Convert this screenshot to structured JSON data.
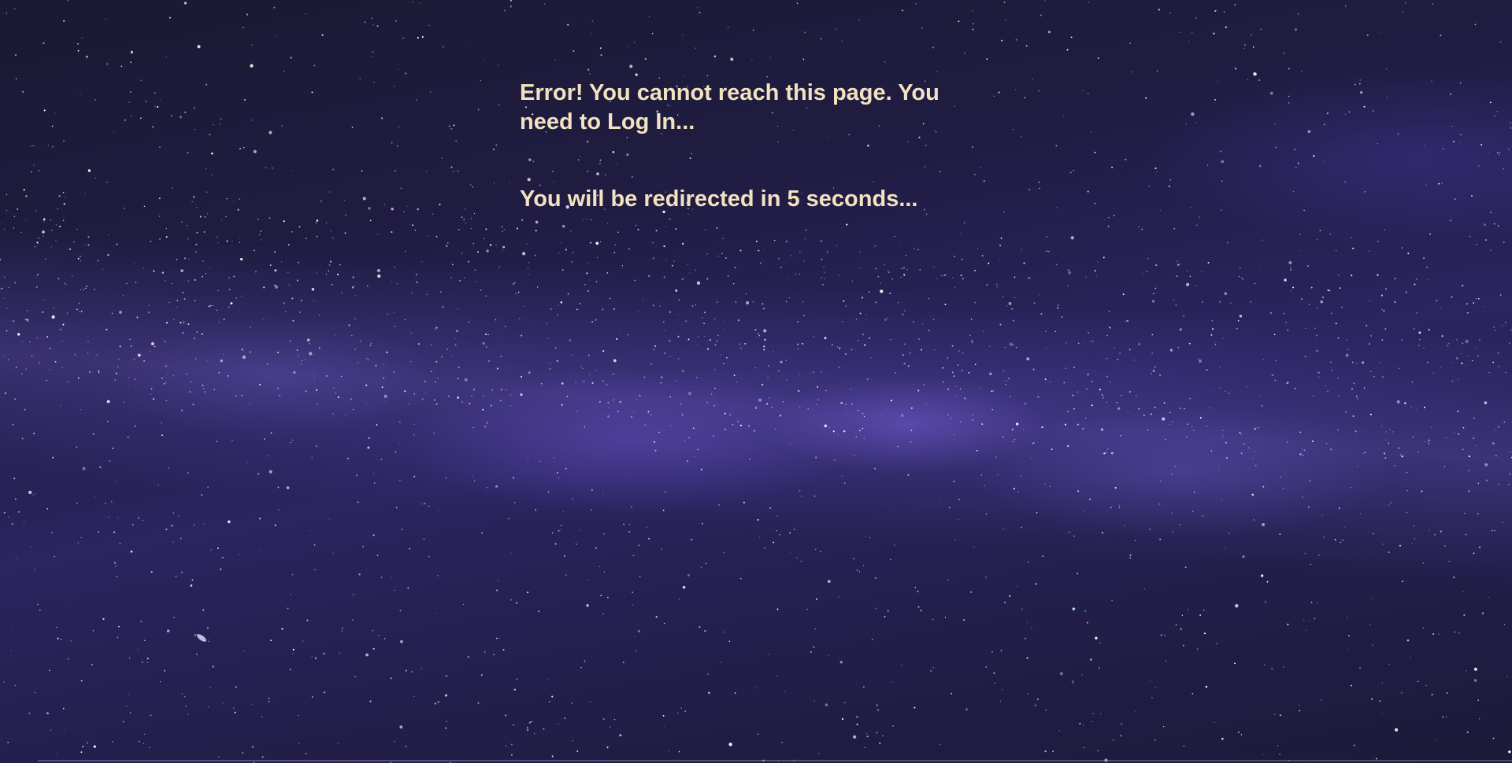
{
  "error_message": "Error! You cannot reach this page. You need to Log In...",
  "redirect_message": "You will be redirected in 5 seconds...",
  "colors": {
    "text": "#f3e2bf",
    "sky_dark": "#1a1a33",
    "sky_purple": "#2b2460"
  }
}
